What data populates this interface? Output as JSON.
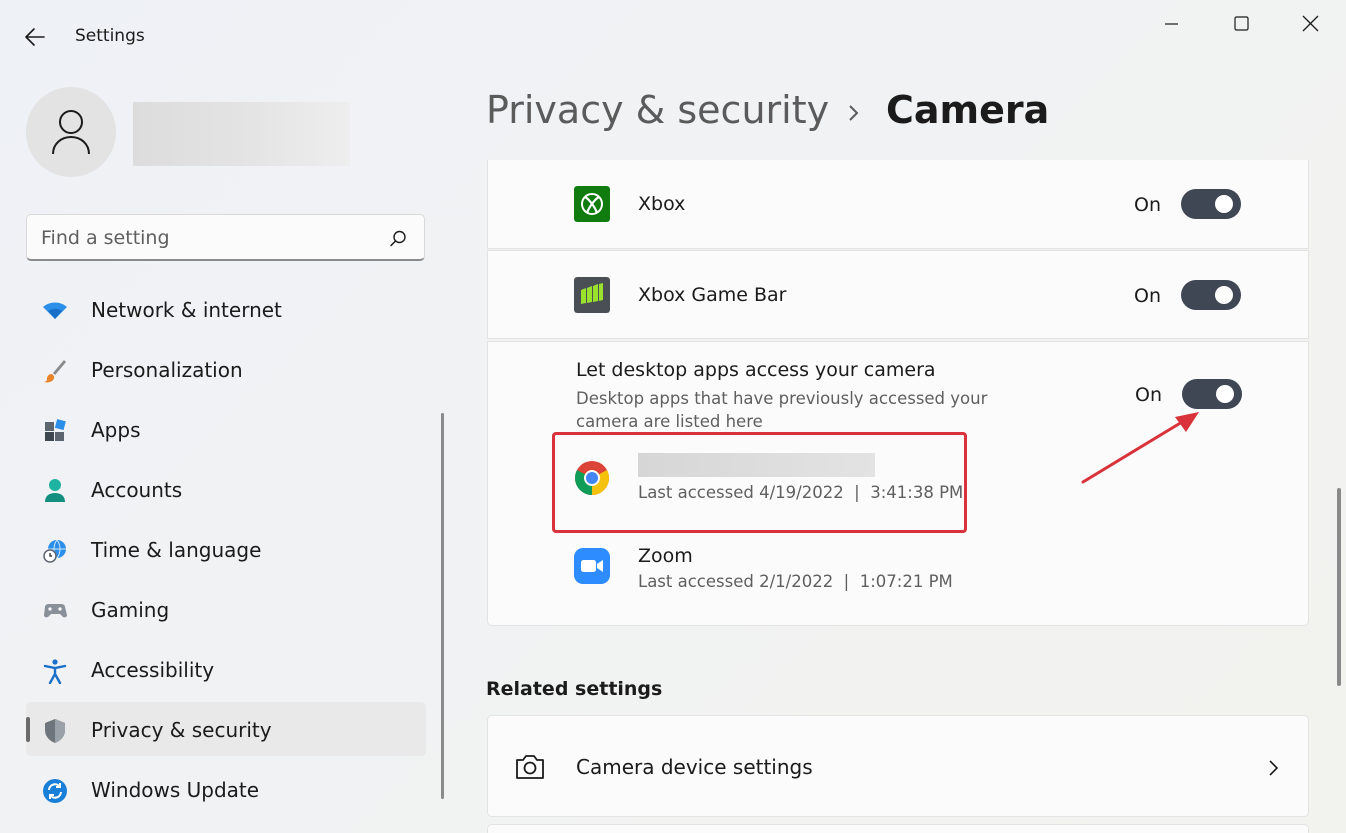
{
  "window": {
    "title": "Settings",
    "controls": [
      "minimize-icon",
      "maximize-icon",
      "close-icon"
    ]
  },
  "user": {
    "avatar_icon": "person-icon"
  },
  "search": {
    "placeholder": "Find a setting",
    "icon": "search-icon"
  },
  "sidebar": {
    "items": [
      {
        "label": "Network & internet",
        "icon": "wifi-icon"
      },
      {
        "label": "Personalization",
        "icon": "brush-icon"
      },
      {
        "label": "Apps",
        "icon": "apps-icon"
      },
      {
        "label": "Accounts",
        "icon": "accounts-icon"
      },
      {
        "label": "Time & language",
        "icon": "globe-clock-icon"
      },
      {
        "label": "Gaming",
        "icon": "gamepad-icon"
      },
      {
        "label": "Accessibility",
        "icon": "accessibility-icon"
      },
      {
        "label": "Privacy & security",
        "icon": "shield-icon",
        "selected": true
      },
      {
        "label": "Windows Update",
        "icon": "update-icon"
      }
    ]
  },
  "breadcrumb": {
    "parent": "Privacy & security",
    "current": "Camera"
  },
  "apps": [
    {
      "name": "Xbox",
      "state": "On",
      "icon": "xbox-icon"
    },
    {
      "name": "Xbox Game Bar",
      "state": "On",
      "icon": "xbox-game-bar-icon"
    }
  ],
  "desktop_apps": {
    "title": "Let desktop apps access your camera",
    "description": "Desktop apps that have previously accessed your camera are listed here",
    "state": "On",
    "list": [
      {
        "icon": "chrome-icon",
        "last_accessed": "Last accessed 4/19/2022  |  3:41:38 PM"
      },
      {
        "name": "Zoom",
        "icon": "zoom-icon",
        "last_accessed": "Last accessed 2/1/2022  |  1:07:21 PM"
      }
    ]
  },
  "related": {
    "title": "Related settings",
    "items": [
      {
        "label": "Camera device settings",
        "icon": "camera-icon"
      }
    ]
  },
  "colors": {
    "accent_toggle": "#3f4654",
    "highlight": "#d9323a",
    "xbox_green": "#107c10"
  }
}
